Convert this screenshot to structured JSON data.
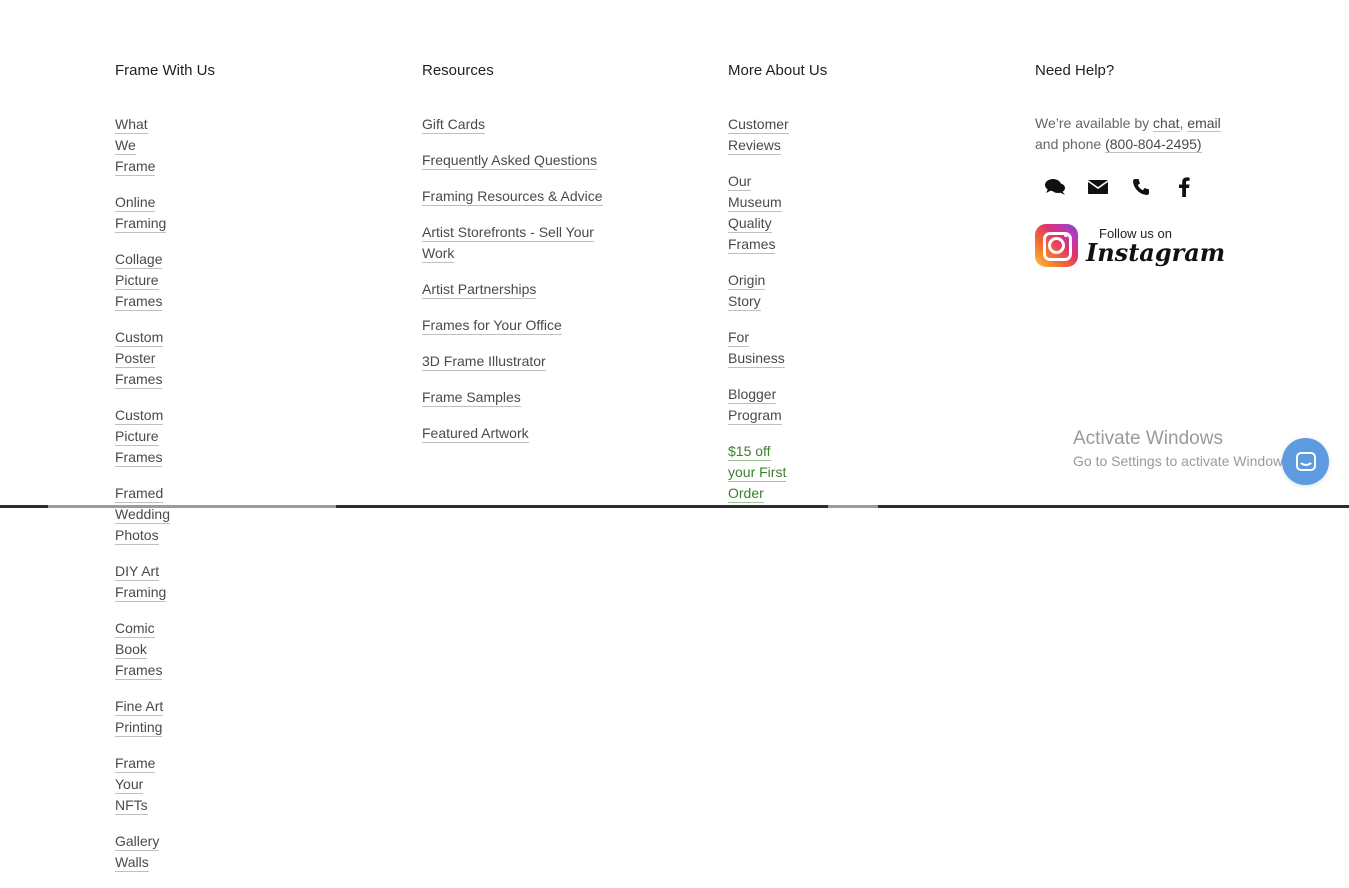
{
  "columns": [
    {
      "heading": "Frame With Us",
      "links": [
        "What We Frame",
        "Online Framing",
        "Collage Picture Frames",
        "Custom Poster Frames",
        "Custom Picture Frames",
        "Framed Wedding Photos",
        "DIY Art Framing",
        "Comic Book Frames",
        "Fine Art Printing",
        "Frame Your NFTs",
        "Gallery Walls"
      ]
    },
    {
      "heading": "Resources",
      "links": [
        "Gift Cards",
        "Frequently Asked Questions",
        "Framing Resources & Advice",
        "Artist Storefronts - Sell Your Work",
        "Artist Partnerships",
        "Frames for Your Office",
        "3D Frame Illustrator",
        "Frame Samples",
        "Featured Artwork"
      ]
    },
    {
      "heading": "More About Us",
      "links": [
        "Customer Reviews",
        "Our Museum Quality Frames",
        "Origin Story",
        "For Business",
        "Blogger Program",
        "$15 off your First Order"
      ]
    }
  ],
  "help": {
    "heading": "Need Help?",
    "text_prefix": "We’re available by ",
    "chat_link": "chat",
    "comma": ", ",
    "email_link": "email",
    "text_middle": " and phone ",
    "phone_link": "(800-804-2495)",
    "icons": [
      "chat-icon",
      "email-icon",
      "phone-icon",
      "facebook-icon"
    ],
    "instagram_small": "Follow us on",
    "instagram_big": "Instagram"
  },
  "watermark": {
    "title": "Activate Windows",
    "subtitle": "Go to Settings to activate Windows."
  },
  "colors": {
    "link": "#4a4a4a",
    "promo_link": "#3c7f2e",
    "chat_bubble": "#5d9be0"
  }
}
